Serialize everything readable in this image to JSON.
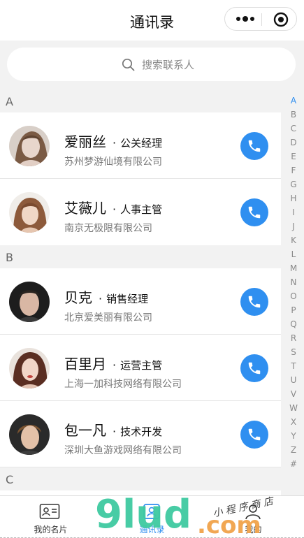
{
  "header": {
    "title": "通讯录"
  },
  "search": {
    "placeholder": "搜索联系人"
  },
  "sections": [
    {
      "letter": "A",
      "contacts": [
        {
          "name": "爱丽丝",
          "role": "公关经理",
          "company": "苏州梦游仙境有限公司"
        },
        {
          "name": "艾薇儿",
          "role": "人事主管",
          "company": "南京无极限有限公司"
        }
      ]
    },
    {
      "letter": "B",
      "contacts": [
        {
          "name": "贝克",
          "role": "销售经理",
          "company": "北京爱美丽有限公司"
        },
        {
          "name": "百里月",
          "role": "运营主管",
          "company": "上海一加科技网络有限公司"
        },
        {
          "name": "包一凡",
          "role": "技术开发",
          "company": "深圳大鱼游戏网络有限公司"
        }
      ]
    },
    {
      "letter": "C",
      "contacts": []
    }
  ],
  "index_letters": [
    "A",
    "B",
    "C",
    "D",
    "E",
    "F",
    "G",
    "H",
    "I",
    "J",
    "K",
    "L",
    "M",
    "N",
    "O",
    "P",
    "Q",
    "R",
    "S",
    "T",
    "U",
    "V",
    "W",
    "X",
    "Y",
    "Z",
    "#"
  ],
  "active_index": "A",
  "tabs": [
    {
      "label": "我的名片",
      "icon": "card-icon"
    },
    {
      "label": "通讯录",
      "icon": "contacts-icon"
    },
    {
      "label": "我的",
      "icon": "person-icon"
    }
  ],
  "watermark": {
    "text": "9lud.com",
    "subtext": "小 程 序 商 店"
  },
  "colors": {
    "accent": "#2f8ff0",
    "watermark_green": "#3ec9a0",
    "watermark_orange": "#f0a24a"
  }
}
